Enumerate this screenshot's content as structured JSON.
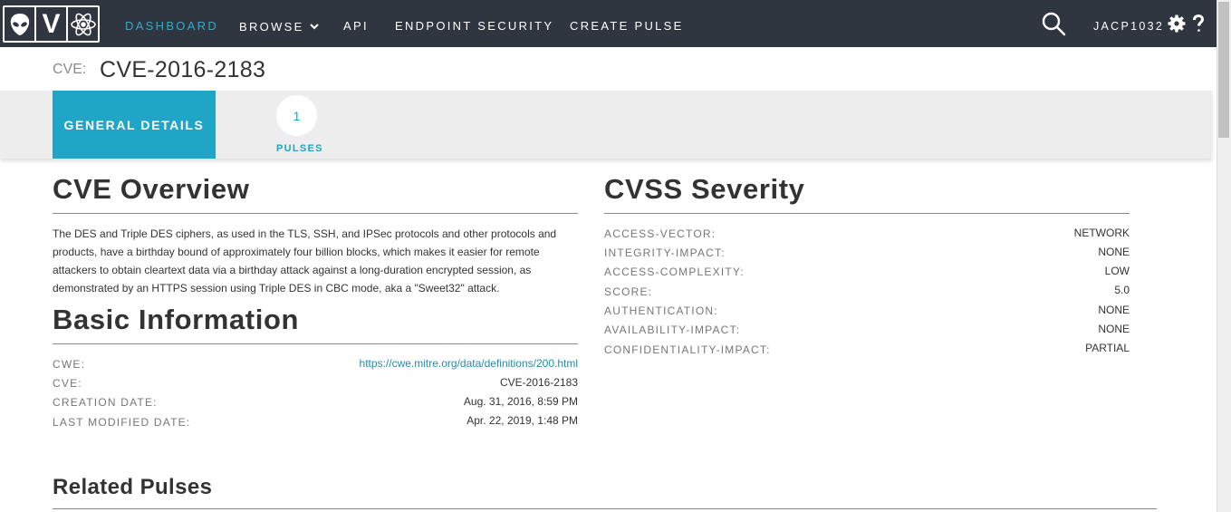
{
  "nav": {
    "logo_letter": "V",
    "items": [
      "DASHBOARD",
      "BROWSE",
      "API",
      "ENDPOINT SECURITY",
      "CREATE PULSE"
    ],
    "user": "JACP1032",
    "accent": "#35a9c9",
    "background": "#2f3640"
  },
  "header": {
    "label": "CVE:",
    "title": "CVE-2016-2183"
  },
  "tabs": {
    "general": "GENERAL DETAILS",
    "pulses_count": "1",
    "pulses_label": "PULSES"
  },
  "overview": {
    "heading": "CVE Overview",
    "text": "The DES and Triple DES ciphers, as used in the TLS, SSH, and IPSec protocols and other protocols and products, have a birthday bound of approximately four billion blocks, which makes it easier for remote attackers to obtain cleartext data via a birthday attack against a long-duration encrypted session, as demonstrated by an HTTPS session using Triple DES in CBC mode, aka a \"Sweet32\" attack."
  },
  "basic": {
    "heading": "Basic Information",
    "rows": [
      {
        "label": "CWE:",
        "value": "https://cwe.mitre.org/data/definitions/200.html"
      },
      {
        "label": "CVE:",
        "value": "CVE-2016-2183"
      },
      {
        "label": "CREATION DATE:",
        "value": "Aug. 31, 2016, 8:59 PM"
      },
      {
        "label": "LAST MODIFIED DATE:",
        "value": "Apr. 22, 2019, 1:48 PM"
      }
    ]
  },
  "cvss": {
    "heading": "CVSS Severity",
    "rows": [
      {
        "label": "ACCESS-VECTOR:",
        "value": "NETWORK"
      },
      {
        "label": "INTEGRITY-IMPACT:",
        "value": "NONE"
      },
      {
        "label": "ACCESS-COMPLEXITY:",
        "value": "LOW"
      },
      {
        "label": "SCORE:",
        "value": "5.0"
      },
      {
        "label": "AUTHENTICATION:",
        "value": "NONE"
      },
      {
        "label": "AVAILABILITY-IMPACT:",
        "value": "NONE"
      },
      {
        "label": "CONFIDENTIALITY-IMPACT:",
        "value": "PARTIAL"
      }
    ]
  },
  "related": {
    "heading": "Related Pulses"
  },
  "icons": [
    "alien-logo-icon",
    "atom-logo-icon",
    "chevron-down-icon",
    "search-icon",
    "gear-icon",
    "help-icon"
  ]
}
